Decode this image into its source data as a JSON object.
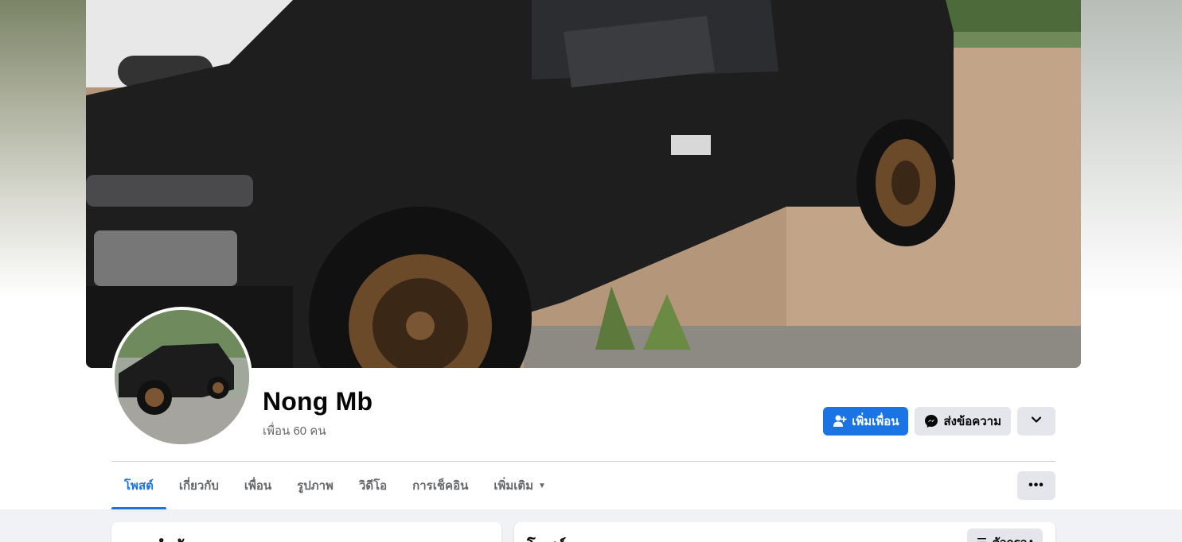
{
  "profile": {
    "name": "Nong Mb",
    "friend_count_text": "เพื่อน 60 คน"
  },
  "actions": {
    "add_friend_label": "เพิ่มเพื่อน",
    "message_label": "ส่งข้อความ",
    "dropdown_icon": "chevron-down-icon"
  },
  "tabs": [
    {
      "label": "โพสต์",
      "active": true
    },
    {
      "label": "เกี่ยวกับ"
    },
    {
      "label": "เพื่อน"
    },
    {
      "label": "รูปภาพ"
    },
    {
      "label": "วิดีโอ"
    },
    {
      "label": "การเช็คอิน"
    },
    {
      "label": "เพิ่มเติม"
    }
  ],
  "more_menu_icon": "ellipsis-icon",
  "intro_card": {
    "title": "แนะนำตัว"
  },
  "posts_card": {
    "title": "โพสต์",
    "filter_label": "ตัวกรอง"
  },
  "colors": {
    "accent": "#1b74e4",
    "secondary_button": "#e4e6eb",
    "feed_background": "#f0f2f5",
    "muted_text": "#65676b"
  }
}
